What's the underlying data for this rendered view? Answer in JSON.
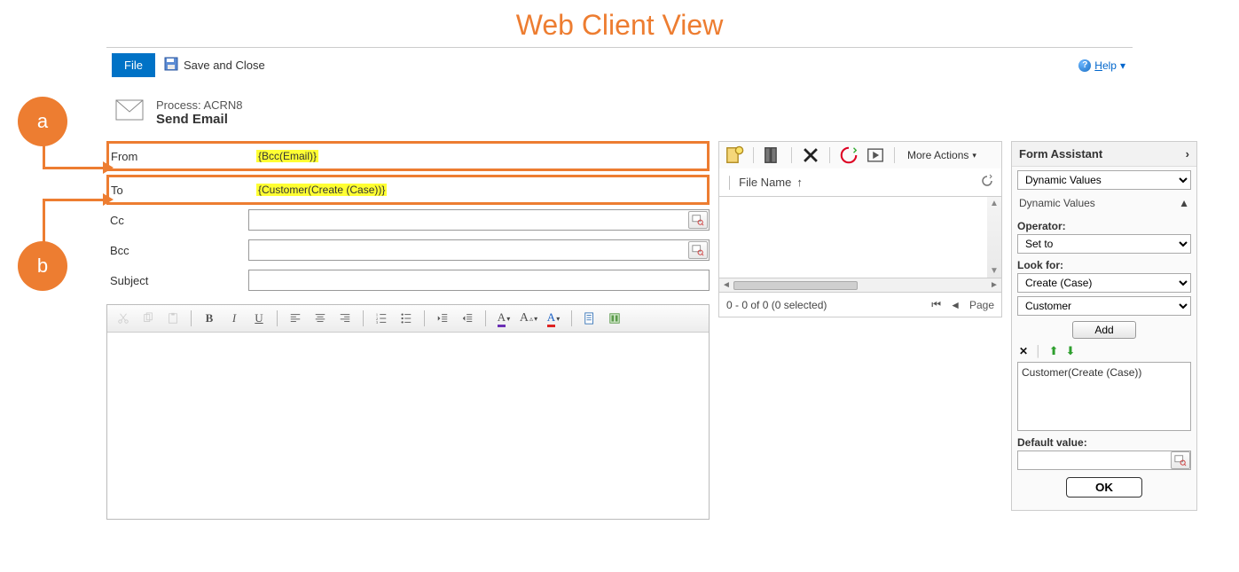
{
  "annotation": {
    "title": "Web Client View",
    "badge_a": "a",
    "badge_b": "b"
  },
  "topbar": {
    "file_label": "File",
    "save_close_label": "Save and Close",
    "help_label": "Help",
    "help_caret": "▾"
  },
  "process": {
    "line1": "Process: ACRN8",
    "line2": "Send Email"
  },
  "fields": {
    "from": {
      "label": "From",
      "value": "{Bcc(Email)}"
    },
    "to": {
      "label": "To",
      "value": "{Customer(Create (Case))}"
    },
    "cc": {
      "label": "Cc",
      "value": ""
    },
    "bcc": {
      "label": "Bcc",
      "value": ""
    },
    "subject": {
      "label": "Subject",
      "value": ""
    }
  },
  "rte_icons": {
    "bold": "B",
    "italic": "I",
    "underline": "U",
    "hilite_a": "A",
    "font_a": "A",
    "color_a": "A"
  },
  "grid": {
    "more_actions": "More Actions",
    "col_filename": "File Name",
    "sort_arrow": "↑",
    "status": "0 - 0 of 0 (0 selected)",
    "page_label": "Page"
  },
  "form_assistant": {
    "title": "Form Assistant",
    "top_select": "Dynamic Values",
    "section_label": "Dynamic Values",
    "operator_label": "Operator:",
    "operator_value": "Set to",
    "lookfor_label": "Look for:",
    "lookfor_value1": "Create (Case)",
    "lookfor_value2": "Customer",
    "add_label": "Add",
    "list_item0": "Customer(Create (Case))",
    "default_label": "Default value:",
    "default_value": "",
    "ok_label": "OK"
  }
}
